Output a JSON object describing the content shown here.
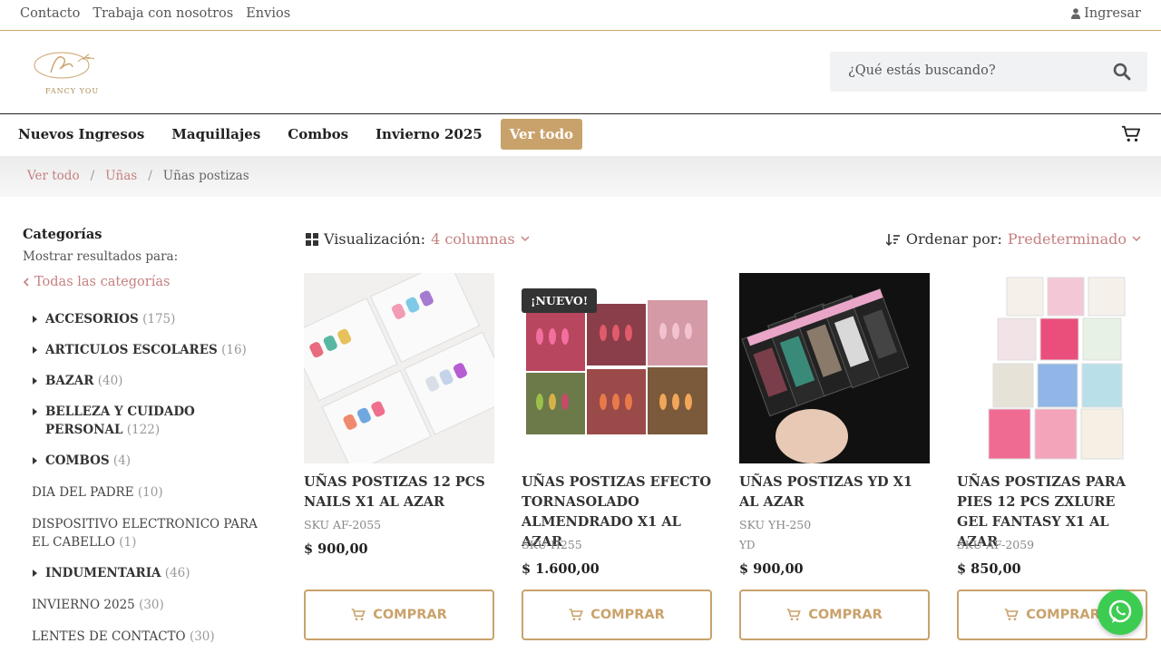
{
  "topbar": {
    "links": [
      "Contacto",
      "Trabaja con nosotros",
      "Envios"
    ],
    "login": "Ingresar"
  },
  "header": {
    "logo_text": "FANCY YOU",
    "search_placeholder": "¿Qué estás buscando?"
  },
  "nav": {
    "items": [
      "Nuevos Ingresos",
      "Maquillajes",
      "Combos",
      "Invierno 2025",
      "Ver todo"
    ]
  },
  "breadcrumb": [
    "Ver todo",
    "Uñas",
    "Uñas postizas"
  ],
  "sidebar": {
    "title": "Categorías",
    "subtitle": "Mostrar resultados para:",
    "all_link": "Todas las categorías",
    "categories": [
      {
        "name": "ACCESORIOS",
        "count": "(175)"
      },
      {
        "name": "ARTICULOS ESCOLARES",
        "count": "(16)"
      },
      {
        "name": "BAZAR",
        "count": "(40)"
      },
      {
        "name": "BELLEZA Y CUIDADO PERSONAL",
        "count": "(122)"
      },
      {
        "name": "COMBOS",
        "count": "(4)"
      },
      {
        "name": "DIA DEL PADRE",
        "count": "(10)"
      },
      {
        "name": "DISPOSITIVO ELECTRONICO PARA EL CABELLO",
        "count": "(1)"
      },
      {
        "name": "INDUMENTARIA",
        "count": "(46)"
      },
      {
        "name": "INVIERNO 2025",
        "count": "(30)"
      },
      {
        "name": "LENTES DE CONTACTO",
        "count": "(30)"
      }
    ]
  },
  "toolbar": {
    "view_label": "Visualización:",
    "view_value": "4 columnas",
    "sort_label": "Ordenar por:",
    "sort_value": "Predeterminado"
  },
  "products": [
    {
      "name": "UÑAS POSTIZAS 12 PCS NAILS X1 AL AZAR",
      "sku": "SKU AF-2055",
      "brand": "",
      "price": "$  900,00",
      "button": "COMPRAR"
    },
    {
      "name": "UÑAS POSTIZAS EFECTO TORNASOLADO ALMENDRADO X1 AL AZAR",
      "sku": "SKU H255",
      "brand": "",
      "price": "$  1.600,00",
      "button": "COMPRAR",
      "badge": "¡NUEVO!"
    },
    {
      "name": "UÑAS POSTIZAS YD X1 AL AZAR",
      "sku": "SKU YH-250",
      "brand": "YD",
      "price": "$  900,00",
      "button": "COMPRAR"
    },
    {
      "name": "UÑAS POSTIZAS PARA PIES 12 PCS ZXLURE GEL FANTASY X1 AL AZAR",
      "sku": "SKU AF-2059",
      "brand": "",
      "price": "$  850,00",
      "button": "COMPRAR"
    }
  ],
  "colors": {
    "accent": "#c9a26b",
    "link": "#c57f80",
    "whatsapp": "#3dcc52"
  }
}
